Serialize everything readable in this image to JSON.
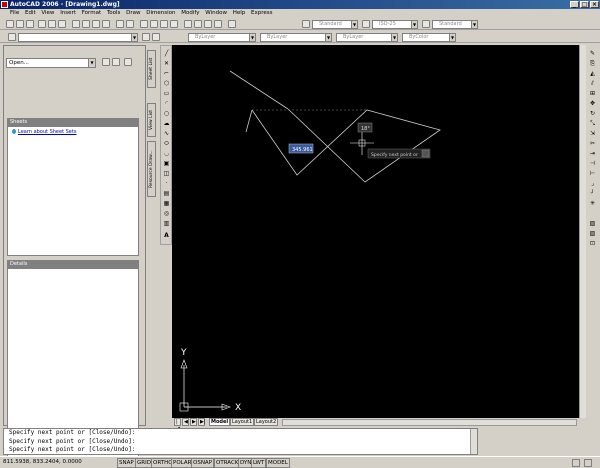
{
  "window": {
    "title": "AutoCAD 2006 - [Drawing1.dwg]",
    "min": "_",
    "max": "□",
    "close": "×"
  },
  "menu": [
    "File",
    "Edit",
    "View",
    "Insert",
    "Format",
    "Tools",
    "Draw",
    "Dimension",
    "Modify",
    "Window",
    "Help",
    "Express"
  ],
  "styles_toolbar": {
    "text_style": "Standard",
    "dim_style": "ISO-25",
    "table_style": "Standard"
  },
  "properties_toolbar": {
    "layer": "ByLayer",
    "linetype": "ByLayer",
    "lineweight": "ByLayer",
    "plot_style": "ByColor"
  },
  "sheet_palette": {
    "open_value": "Open...",
    "sheets_header": "Sheets",
    "learn_link": "Learn about Sheet Sets",
    "details_header": "Details",
    "tabs": [
      "Sheet List",
      "View List",
      "Resource Draw..."
    ]
  },
  "canvas": {
    "dim_input": "345.961",
    "angle_input": "18°",
    "prompt": "Specify next point or",
    "ucs_y": "Y",
    "ucs_x": "X"
  },
  "layout_tabs": [
    "Model",
    "Layout1",
    "Layout2"
  ],
  "command_lines": [
    "Specify next point or [Close/Undo]:",
    "Specify next point or [Close/Undo]:",
    "Specify next point or [Close/Undo]:"
  ],
  "status": {
    "coords": "811.5938, 833.2404, 0.0000",
    "buttons": [
      "SNAP",
      "GRID",
      "ORTHO",
      "POLAR",
      "OSNAP",
      "OTRACK",
      "DYN",
      "LWT",
      "MODEL"
    ]
  },
  "icons": {
    "draw_text_tool": "A"
  }
}
